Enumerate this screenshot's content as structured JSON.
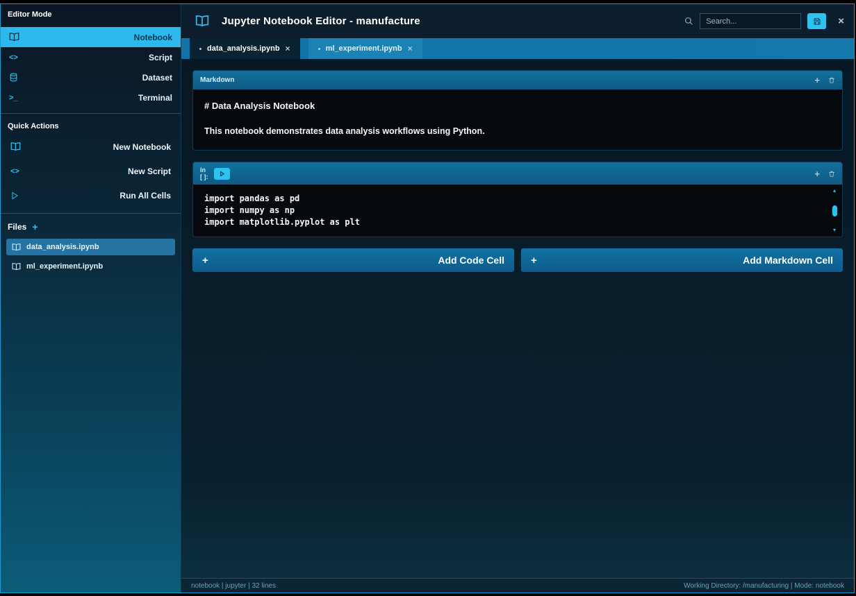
{
  "colors": {
    "accent": "#2fc1f0",
    "window_border": "#1b9bd0",
    "tab_bar": "#1277aa",
    "active_mode_bg": "#2eb9ee"
  },
  "icons": {
    "code_glyph": "<>",
    "terminal_glyph": ">_",
    "plus": "+",
    "close": "×",
    "scroll_up": "▴",
    "scroll_down": "▾"
  },
  "sidebar": {
    "title": "Editor Mode",
    "modes": [
      {
        "label": "Notebook",
        "active": true
      },
      {
        "label": "Script",
        "active": false
      },
      {
        "label": "Dataset",
        "active": false
      },
      {
        "label": "Terminal",
        "active": false
      }
    ],
    "quick_actions": {
      "title": "Quick Actions",
      "items": [
        {
          "label": "New Notebook"
        },
        {
          "label": "New Script"
        },
        {
          "label": "Run All Cells"
        }
      ]
    },
    "files": {
      "title": "Files",
      "add_label": "+",
      "items": [
        {
          "label": "data_analysis.ipynb",
          "selected": true
        },
        {
          "label": "ml_experiment.ipynb",
          "selected": false
        }
      ]
    }
  },
  "header": {
    "title": "Jupyter Notebook Editor - manufacture",
    "search": {
      "placeholder": "Search..."
    },
    "close_label": "×"
  },
  "tabs": {
    "items": [
      {
        "label": "data_analysis.ipynb",
        "close_label": "×",
        "active": true
      },
      {
        "label": "ml_experiment.ipynb",
        "close_label": "×",
        "active": false
      }
    ]
  },
  "notebook": {
    "markdown_cell": {
      "header_label": "Markdown",
      "add_label": "+",
      "heading": "# Data Analysis Notebook",
      "paragraph": "This notebook demonstrates data analysis workflows using Python."
    },
    "code_cell": {
      "prompt_top": "In",
      "prompt_bottom": "[ ]:",
      "add_label": "+",
      "code_lines": [
        "import pandas as pd",
        "import numpy as np",
        "import matplotlib.pyplot as plt"
      ]
    },
    "add_code_cell": {
      "plus": "+",
      "label": "Add Code Cell"
    },
    "add_markdown_cell": {
      "plus": "+",
      "label": "Add Markdown Cell"
    }
  },
  "status_bar": {
    "left": "notebook | jupyter | 32 lines",
    "right": "Working Directory: /manufacturing | Mode: notebook"
  }
}
